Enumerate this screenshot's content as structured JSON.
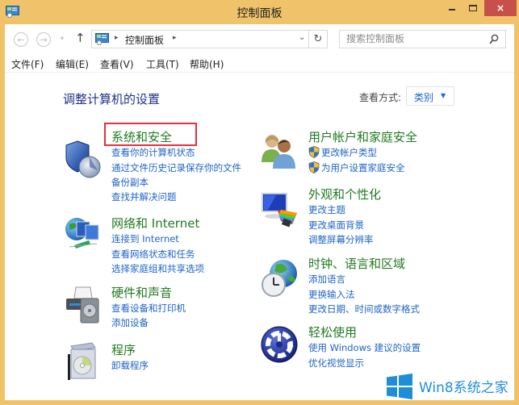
{
  "window": {
    "title": "控制面板",
    "close_glyph": "×"
  },
  "navbar": {
    "back_glyph": "←",
    "forward_glyph": "→",
    "recent_glyph": "▾",
    "up_glyph": "↑",
    "address": {
      "separator": "▸",
      "path": [
        "控制面板"
      ],
      "dropdown_glyph": "⌄"
    },
    "refresh_glyph": "↻",
    "search": {
      "placeholder": "搜索控制面板",
      "value": ""
    }
  },
  "menubar": {
    "items": [
      {
        "label": "文件(F)"
      },
      {
        "label": "编辑(E)"
      },
      {
        "label": "查看(V)"
      },
      {
        "label": "工具(T)"
      },
      {
        "label": "帮助(H)"
      }
    ]
  },
  "content": {
    "heading": "调整计算机的设置",
    "view_by_label": "查看方式:",
    "view_by_value": "类别",
    "view_by_arrow": "▼",
    "left_categories": [
      {
        "icon": "shield-pie-chart-icon",
        "title": "系统和安全",
        "highlighted": true,
        "links": [
          "查看你的计算机状态",
          "通过文件历史记录保存你的文件",
          "备份副本",
          "查找并解决问题"
        ]
      },
      {
        "icon": "globe-network-icon",
        "title": "网络和 Internet",
        "links": [
          "连接到 Internet",
          "查看网络状态和任务",
          "选择家庭组和共享选项"
        ]
      },
      {
        "icon": "printer-speaker-icon",
        "title": "硬件和声音",
        "links": [
          "查看设备和打印机",
          "添加设备"
        ]
      },
      {
        "icon": "program-box-cd-icon",
        "title": "程序",
        "links": [
          "卸载程序"
        ]
      }
    ],
    "right_categories": [
      {
        "icon": "users-icon",
        "title": "用户帐户和家庭安全",
        "links": [
          "更改帐户类型",
          "为用户设置家庭安全"
        ],
        "links_have_uac_shield": true
      },
      {
        "icon": "monitor-palette-icon",
        "title": "外观和个性化",
        "links": [
          "更改主题",
          "更改桌面背景",
          "调整屏幕分辨率"
        ]
      },
      {
        "icon": "globe-clock-icon",
        "title": "时钟、语言和区域",
        "links": [
          "添加语言",
          "更换输入法",
          "更改日期、时间或数字格式"
        ]
      },
      {
        "icon": "ease-of-access-icon",
        "title": "轻松使用",
        "links": [
          "使用 Windows 建议的设置",
          "优化视觉显示"
        ]
      }
    ]
  },
  "watermark": {
    "text": "Win8系统之家"
  },
  "colors": {
    "frame": "#f0c36a",
    "close_button": "#c7504a",
    "category_title": "#217a21",
    "link": "#1e64c8",
    "heading": "#1e3287",
    "highlight_box": "#e8303a",
    "watermark": "#1e8fd6"
  }
}
